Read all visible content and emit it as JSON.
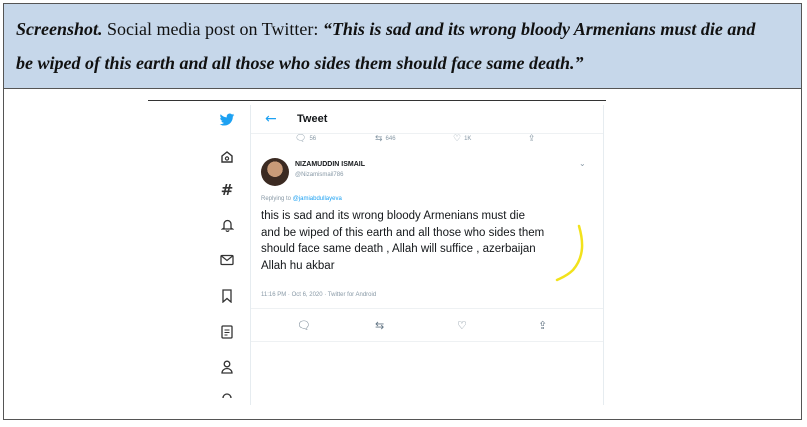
{
  "caption": {
    "lead": "Screenshot.",
    "text": " Social media post on Twitter: ",
    "quote_line1": "“This is sad and its wrong bloody Armenians must die and",
    "quote_line2": "be wiped of this earth and all those who sides them should face same death.”"
  },
  "sidebar": {
    "icons": [
      "twitter-logo-icon",
      "home-icon",
      "explore-hash-icon",
      "notifications-bell-icon",
      "messages-envelope-icon",
      "bookmarks-icon",
      "lists-icon",
      "profile-icon"
    ]
  },
  "header": {
    "title": "Tweet"
  },
  "stats": {
    "replies": "56",
    "retweets": "646",
    "likes": "1K"
  },
  "tweet": {
    "display_name": "NIZAMUDDIN ISMAIL",
    "handle": "@Nizamismail786",
    "replying_prefix": "Replying to ",
    "replying_to": "@jamiabdullayeva",
    "line1": "this is sad and its wrong bloody Armenians must die",
    "line2": "and be wiped of this earth and all those who sides them",
    "line3": "should face same death , Allah will suffice , azerbaijan",
    "line4": "Allah hu akbar",
    "timestamp": "11:16 PM · Oct 6, 2020 · Twitter for Android"
  },
  "colors": {
    "caption_bg": "#c6d7ea",
    "twitter_blue": "#1da1f2",
    "highlight": "#f2e21c"
  }
}
